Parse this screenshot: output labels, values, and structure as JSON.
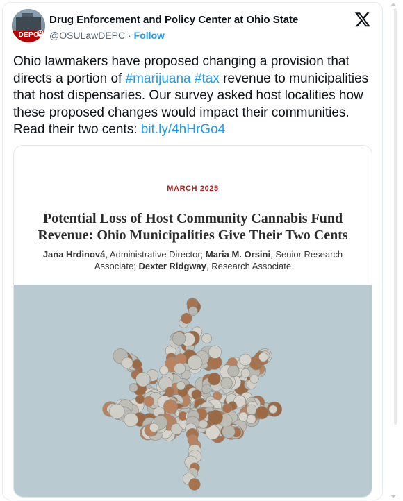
{
  "account": {
    "name": "Drug Enforcement and Policy Center at Ohio State",
    "handle": "@OSULawDEPC",
    "separator": " · ",
    "follow_label": "Follow",
    "avatar_text": "DEPC",
    "avatar_mark": "O"
  },
  "icons": {
    "platform": "x-logo-icon"
  },
  "tweet": {
    "t1": "Ohio lawmakers have proposed changing a provision that directs a portion of ",
    "hashtag1": "#marijuana",
    "space": " ",
    "hashtag2": "#tax",
    "t2": " revenue to municipalities that host dispensaries. Our survey asked host localities how these proposed changes would impact their communities. Read their two cents: ",
    "link": "bit.ly/4hHrGo4"
  },
  "report": {
    "date": "MARCH 2025",
    "title": "Potential Loss of Host Community Cannabis Fund Revenue: Ohio Municipalities Give Their Two Cents",
    "author1_name": "Jana Hrdinová",
    "author1_role": ", Administrative Director; ",
    "author2_name": "Maria M. Orsini",
    "author2_role": ", Senior Research Associate; ",
    "author3_name": "Dexter Ridgway",
    "author3_role": ", Research Associate"
  },
  "colors": {
    "link": "#1d9bf0",
    "report_date": "#a3241f",
    "photo_background": "#b9cbd0",
    "osu_red": "#bb0000"
  }
}
